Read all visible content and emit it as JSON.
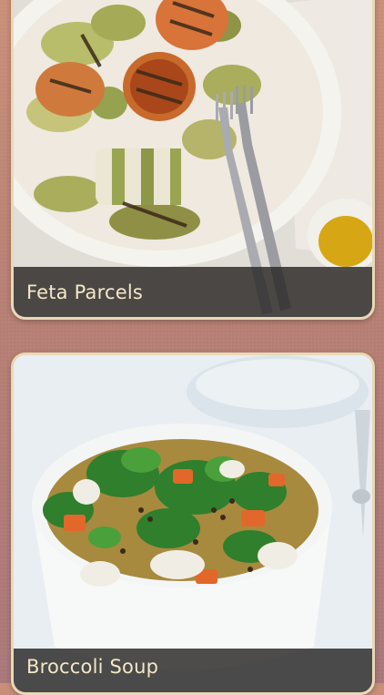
{
  "recipes": [
    {
      "name": "Feta Parcels"
    },
    {
      "name": "Broccoli Soup"
    }
  ],
  "colors": {
    "background": "#b77f73",
    "card_border": "#e8d9b7",
    "caption_bg": "#282624",
    "caption_text": "#f3e7c7"
  }
}
